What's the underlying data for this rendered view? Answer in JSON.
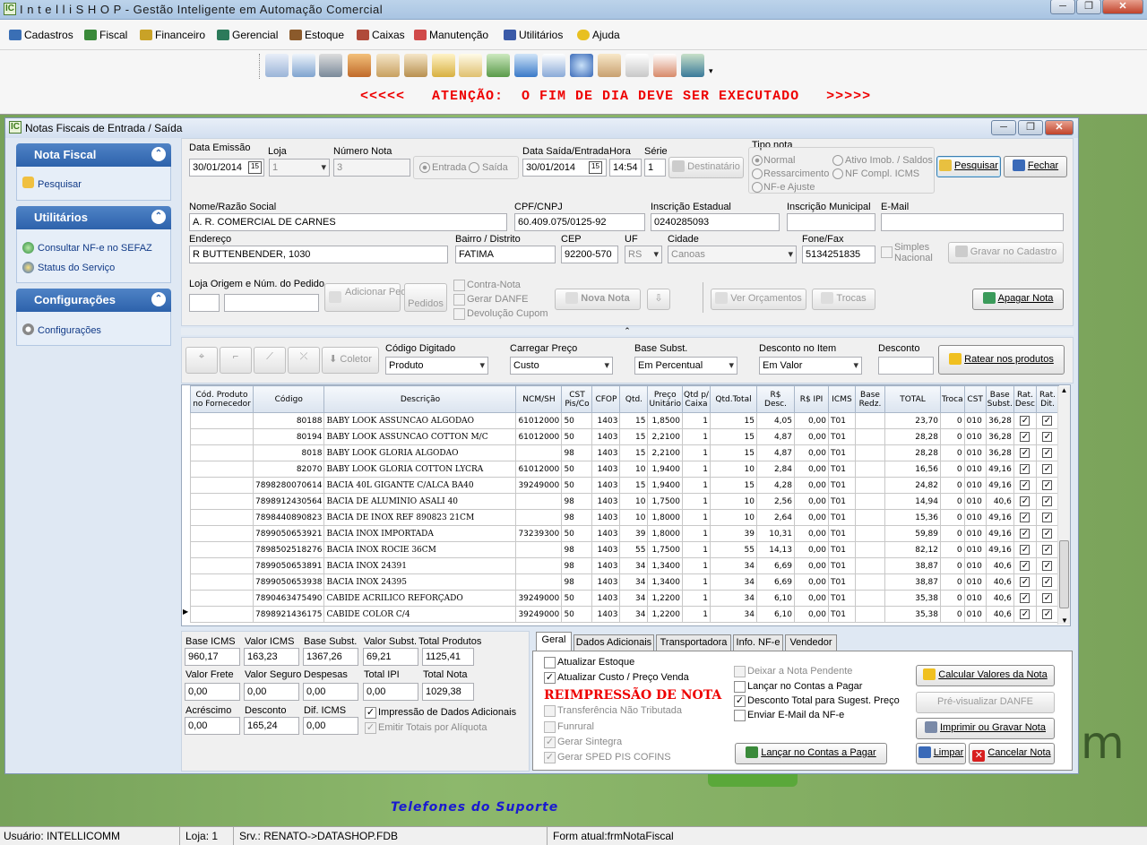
{
  "app": {
    "title_brand": "I n t e l l i S H O P",
    "title_rest": " - Gestão Inteligente em Automação Comercial"
  },
  "menu": [
    "Cadastros",
    "Fiscal",
    "Financeiro",
    "Gerencial",
    "Estoque",
    "Caixas",
    "Manutenção",
    "Utilitários",
    "Ajuda"
  ],
  "alert": "<<<<<   ATENÇÃO:  O FIM DE DIA DEVE SER EXECUTADO   >>>>>",
  "window": {
    "title": "Notas Fiscais de Entrada / Saída"
  },
  "sidebar": {
    "nota": {
      "header": "Nota Fiscal",
      "items": [
        "Pesquisar"
      ]
    },
    "util": {
      "header": "Utilitários",
      "items": [
        "Consultar NF-e no SEFAZ",
        "Status do Serviço"
      ]
    },
    "conf": {
      "header": "Configurações",
      "items": [
        "Configurações"
      ]
    }
  },
  "form": {
    "data_emissao_label": "Data Emissão",
    "data_emissao": "30/01/2014",
    "loja_label": "Loja",
    "loja": "1",
    "numero_label": "Número Nota",
    "numero": "3",
    "entrada": "Entrada",
    "saida": "Saída",
    "data_saida_label": "Data Saída/Entrada",
    "data_saida": "30/01/2014",
    "hora_label": "Hora",
    "hora": "14:54",
    "serie_label": "Série",
    "serie": "1",
    "destinatario": "Destinatário",
    "tipo_label": "Tipo nota",
    "tipo_normal": "Normal",
    "tipo_ativo": "Ativo Imob. / Saldos",
    "tipo_ress": "Ressarcimento",
    "tipo_nfcompl": "NF Compl. ICMS",
    "tipo_ajuste": "NF-e Ajuste",
    "pesquisar": "Pesquisar",
    "fechar": "Fechar",
    "nome_label": "Nome/Razão Social",
    "nome": "A. R. COMERCIAL DE CARNES",
    "cpf_label": "CPF/CNPJ",
    "cpf": "60.409.075/0125-92",
    "ie_label": "Inscrição Estadual",
    "ie": "0240285093",
    "im_label": "Inscrição Municipal",
    "im": "",
    "email_label": "E-Mail",
    "email": "",
    "end_label": "Endereço",
    "end": "R BUTTENBENDER, 1030",
    "bairro_label": "Bairro / Distrito",
    "bairro": "FATIMA",
    "cep_label": "CEP",
    "cep": "92200-570",
    "uf_label": "UF",
    "uf": "RS",
    "cidade_label": "Cidade",
    "cidade": "Canoas",
    "fone_label": "Fone/Fax",
    "fone": "5134251835",
    "simples": "Simples Nacional",
    "gravar": "Gravar no Cadastro",
    "loja_origem_label": "Loja Origem e Núm. do Pedido",
    "adicionar": "Adicionar Pedido...",
    "pedidos": "Pedidos",
    "contra_nota": "Contra-Nota",
    "gerar_danfe": "Gerar DANFE",
    "devolucao": "Devolução Cupom",
    "nova_nota": "Nova Nota",
    "ver_orc": "Ver Orçamentos",
    "trocas": "Trocas",
    "apagar": "Apagar Nota"
  },
  "itembar": {
    "coletor": "Coletor",
    "cod_label": "Código Digitado",
    "cod": "Produto",
    "preco_label": "Carregar Preço",
    "preco": "Custo",
    "base_label": "Base Subst.",
    "base": "Em Percentual",
    "desc_item_label": "Desconto no Item",
    "desc_item": "Em Valor",
    "desconto_label": "Desconto",
    "desconto": "",
    "ratear": "Ratear nos produtos"
  },
  "grid": {
    "headers": [
      "Cód. Produto no Fornecedor",
      "Código",
      "Descrição",
      "NCM/SH",
      "CST Pis/Co",
      "CFOP",
      "Qtd.",
      "Preço Unitário",
      "Qtd p/ Caixa",
      "Qtd.Total",
      "R$ Desc.",
      "R$ IPI",
      "ICMS",
      "Base Redz.",
      "TOTAL",
      "Troca",
      "CST",
      "Base Subst.",
      "Rat. Desc",
      "Rat. Dit."
    ],
    "rows": [
      [
        "",
        "80188",
        "BABY LOOK ASSUNCAO ALGODAO",
        "61012000",
        "50",
        "1403",
        "15",
        "1,8500",
        "1",
        "15",
        "4,05",
        "0,00",
        "T01",
        "",
        "23,70",
        "0",
        "010",
        "36,28"
      ],
      [
        "",
        "80194",
        "BABY LOOK ASSUNCAO COTTON M/C",
        "61012000",
        "50",
        "1403",
        "15",
        "2,2100",
        "1",
        "15",
        "4,87",
        "0,00",
        "T01",
        "",
        "28,28",
        "0",
        "010",
        "36,28"
      ],
      [
        "",
        "8018",
        "BABY LOOK GLORIA ALGODAO",
        "",
        "98",
        "1403",
        "15",
        "2,2100",
        "1",
        "15",
        "4,87",
        "0,00",
        "T01",
        "",
        "28,28",
        "0",
        "010",
        "36,28"
      ],
      [
        "",
        "82070",
        "BABY LOOK GLORIA COTTON LYCRA",
        "61012000",
        "50",
        "1403",
        "10",
        "1,9400",
        "1",
        "10",
        "2,84",
        "0,00",
        "T01",
        "",
        "16,56",
        "0",
        "010",
        "49,16"
      ],
      [
        "",
        "7898280070614",
        "BACIA 40L GIGANTE C/ALCA BA40",
        "39249000",
        "50",
        "1403",
        "15",
        "1,9400",
        "1",
        "15",
        "4,28",
        "0,00",
        "T01",
        "",
        "24,82",
        "0",
        "010",
        "49,16"
      ],
      [
        "",
        "7898912430564",
        "BACIA DE ALUMINIO ASALI 40",
        "",
        "98",
        "1403",
        "10",
        "1,7500",
        "1",
        "10",
        "2,56",
        "0,00",
        "T01",
        "",
        "14,94",
        "0",
        "010",
        "40,6"
      ],
      [
        "",
        "7898440890823",
        "BACIA DE INOX REF 890823  21CM",
        "",
        "98",
        "1403",
        "10",
        "1,8000",
        "1",
        "10",
        "2,64",
        "0,00",
        "T01",
        "",
        "15,36",
        "0",
        "010",
        "49,16"
      ],
      [
        "",
        "7899050653921",
        "BACIA INOX IMPORTADA",
        "73239300",
        "50",
        "1403",
        "39",
        "1,8000",
        "1",
        "39",
        "10,31",
        "0,00",
        "T01",
        "",
        "59,89",
        "0",
        "010",
        "49,16"
      ],
      [
        "",
        "7898502518276",
        "BACIA INOX ROCIE 36CM",
        "",
        "98",
        "1403",
        "55",
        "1,7500",
        "1",
        "55",
        "14,13",
        "0,00",
        "T01",
        "",
        "82,12",
        "0",
        "010",
        "49,16"
      ],
      [
        "",
        "7899050653891",
        "BACIA INOX 24391",
        "",
        "98",
        "1403",
        "34",
        "1,3400",
        "1",
        "34",
        "6,69",
        "0,00",
        "T01",
        "",
        "38,87",
        "0",
        "010",
        "40,6"
      ],
      [
        "",
        "7899050653938",
        "BACIA INOX 24395",
        "",
        "98",
        "1403",
        "34",
        "1,3400",
        "1",
        "34",
        "6,69",
        "0,00",
        "T01",
        "",
        "38,87",
        "0",
        "010",
        "40,6"
      ],
      [
        "",
        "7890463475490",
        "CABIDE ACRILICO REFORÇADO",
        "39249000",
        "50",
        "1403",
        "34",
        "1,2200",
        "1",
        "34",
        "6,10",
        "0,00",
        "T01",
        "",
        "35,38",
        "0",
        "010",
        "40,6"
      ],
      [
        "",
        "7898921436175",
        "CABIDE COLOR C/4",
        "39249000",
        "50",
        "1403",
        "34",
        "1,2200",
        "1",
        "34",
        "6,10",
        "0,00",
        "T01",
        "",
        "35,38",
        "0",
        "010",
        "40,6"
      ]
    ]
  },
  "totals": {
    "base_icms_label": "Base ICMS",
    "base_icms": "960,17",
    "valor_icms_label": "Valor ICMS",
    "valor_icms": "163,23",
    "base_subst_label": "Base Subst.",
    "base_subst": "1367,26",
    "valor_subst_label": "Valor Subst.",
    "valor_subst": "69,21",
    "total_prod_label": "Total Produtos",
    "total_prod": "1125,41",
    "frete_label": "Valor Frete",
    "frete": "0,00",
    "seguro_label": "Valor Seguro",
    "seguro": "0,00",
    "despesas_label": "Despesas",
    "despesas": "0,00",
    "ipi_label": "Total IPI",
    "ipi": "0,00",
    "total_nota_label": "Total Nota",
    "total_nota": "1029,38",
    "acrescimo_label": "Acréscimo",
    "acrescimo": "0,00",
    "desconto_label": "Desconto",
    "desconto": "165,24",
    "dif_label": "Dif. ICMS",
    "dif": "0,00",
    "impressao": "Impressão de Dados Adicionais",
    "emitir": "Emitir Totais por Alíquota"
  },
  "tabs": [
    "Geral",
    "Dados Adicionais",
    "Transportadora",
    "Info. NF-e",
    "Vendedor"
  ],
  "geral": {
    "atualizar_estoque": "Atualizar Estoque",
    "atualizar_custo": "Atualizar Custo / Preço Venda",
    "reimpressao": "REIMPRESSÃO DE NOTA",
    "transf": "Transferência Não Tributada",
    "funrural": "Funrural",
    "sintegra": "Gerar Sintegra",
    "sped": "Gerar SPED PIS COFINS",
    "pendente": "Deixar a Nota Pendente",
    "lancar_chk": "Lançar no Contas a Pagar",
    "desc_total": "Desconto Total para Sugest. Preço",
    "email": "Enviar E-Mail da NF-e",
    "calcular": "Calcular Valores da Nota",
    "previsualizar": "Pré-visualizar DANFE",
    "imprimir": "Imprimir ou Gravar Nota",
    "lancar_btn": "Lançar no Contas a Pagar",
    "limpar": "Limpar",
    "cancelar": "Cancelar Nota"
  },
  "desktop": {
    "suporte": "Telefones do Suporte",
    "m_letter": "m"
  },
  "status": {
    "usuario": "Usuário: INTELLICOMM",
    "loja": "Loja: 1",
    "srv": "Srv.: RENATO->DATASHOP.FDB",
    "form": "Form atual:frmNotaFiscal"
  }
}
